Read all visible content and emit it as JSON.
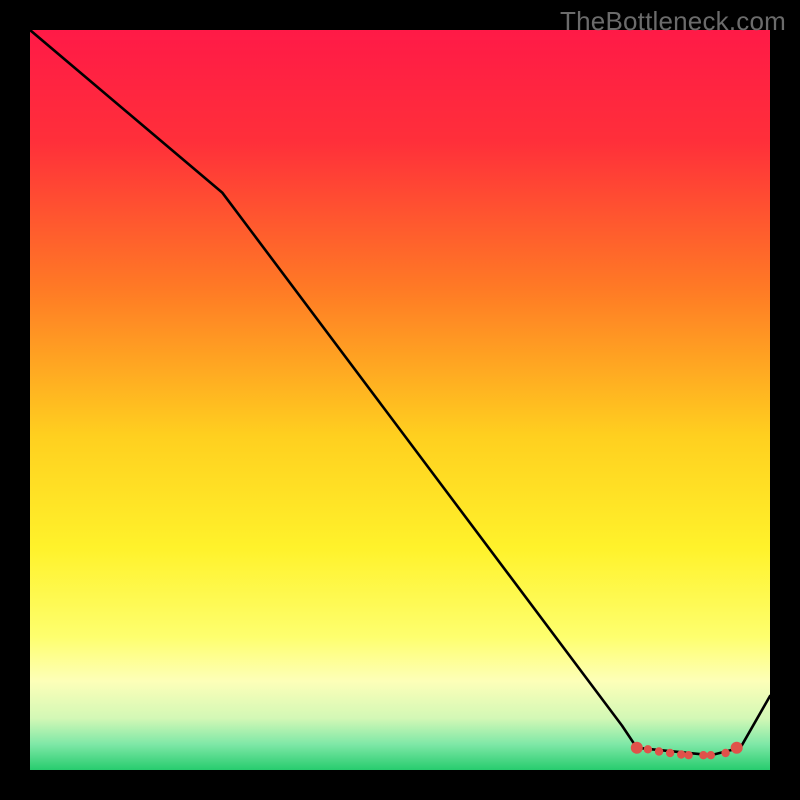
{
  "watermark": "TheBottleneck.com",
  "chart_data": {
    "type": "line",
    "title": "",
    "xlabel": "",
    "ylabel": "",
    "xlim": [
      0,
      100
    ],
    "ylim": [
      0,
      100
    ],
    "grid": false,
    "legend": false,
    "x": [
      0,
      26,
      80,
      82,
      92,
      96,
      100
    ],
    "values": [
      100,
      78,
      6,
      3,
      2,
      3,
      10
    ],
    "marker_points": {
      "x": [
        82,
        83.5,
        85,
        86.5,
        88,
        89,
        91,
        92,
        94,
        95.5
      ],
      "y": [
        3,
        2.8,
        2.5,
        2.3,
        2.1,
        2,
        2,
        2,
        2.3,
        3
      ]
    },
    "gradient_stops": [
      {
        "offset": 0.0,
        "color": "#ff1a47"
      },
      {
        "offset": 0.15,
        "color": "#ff2f3a"
      },
      {
        "offset": 0.35,
        "color": "#ff7a25"
      },
      {
        "offset": 0.55,
        "color": "#ffd01f"
      },
      {
        "offset": 0.7,
        "color": "#fff22b"
      },
      {
        "offset": 0.82,
        "color": "#feff6e"
      },
      {
        "offset": 0.88,
        "color": "#fdffb8"
      },
      {
        "offset": 0.93,
        "color": "#d3f8b6"
      },
      {
        "offset": 0.965,
        "color": "#7fe8a7"
      },
      {
        "offset": 1.0,
        "color": "#27cc6e"
      }
    ],
    "line_color": "#000000",
    "marker_color": "#e0524a",
    "background_outside": "#000000"
  }
}
